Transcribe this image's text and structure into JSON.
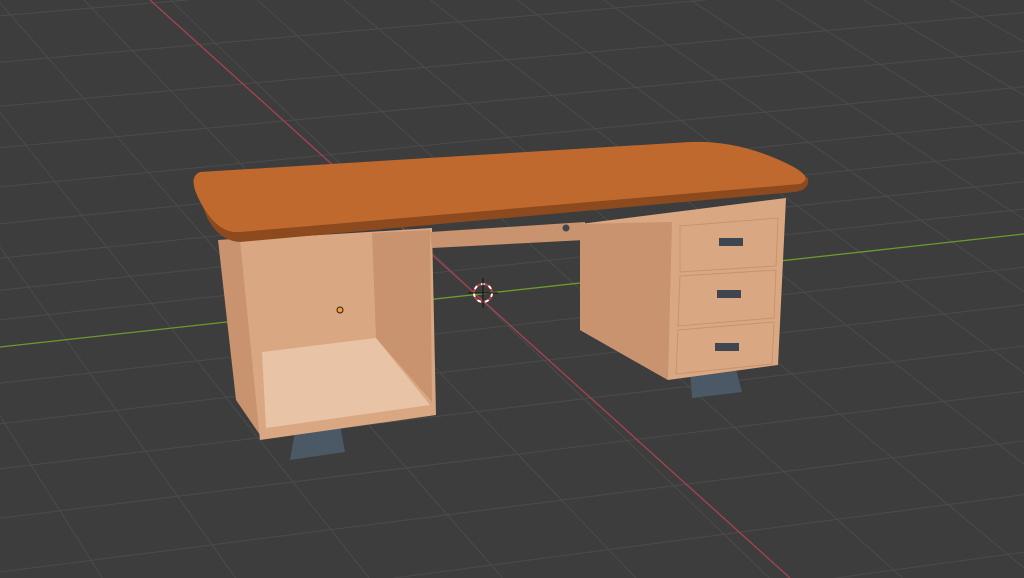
{
  "viewport": {
    "background": "#3d3d3d",
    "grid_color": "#4b4b4b",
    "x_axis_color": "#a8434f",
    "y_axis_color": "#6a9a2e",
    "object": "desk",
    "colors": {
      "wood_top": "#c0692e",
      "wood_edge": "#8c4a1e",
      "body": "#d9a883",
      "body_shade": "#c8936e",
      "cavity": "#e8c3a6",
      "handle": "#3f4650",
      "feet": "#4b5866",
      "cursor": "#d23a3a",
      "origin": "#ff9a2a"
    }
  }
}
